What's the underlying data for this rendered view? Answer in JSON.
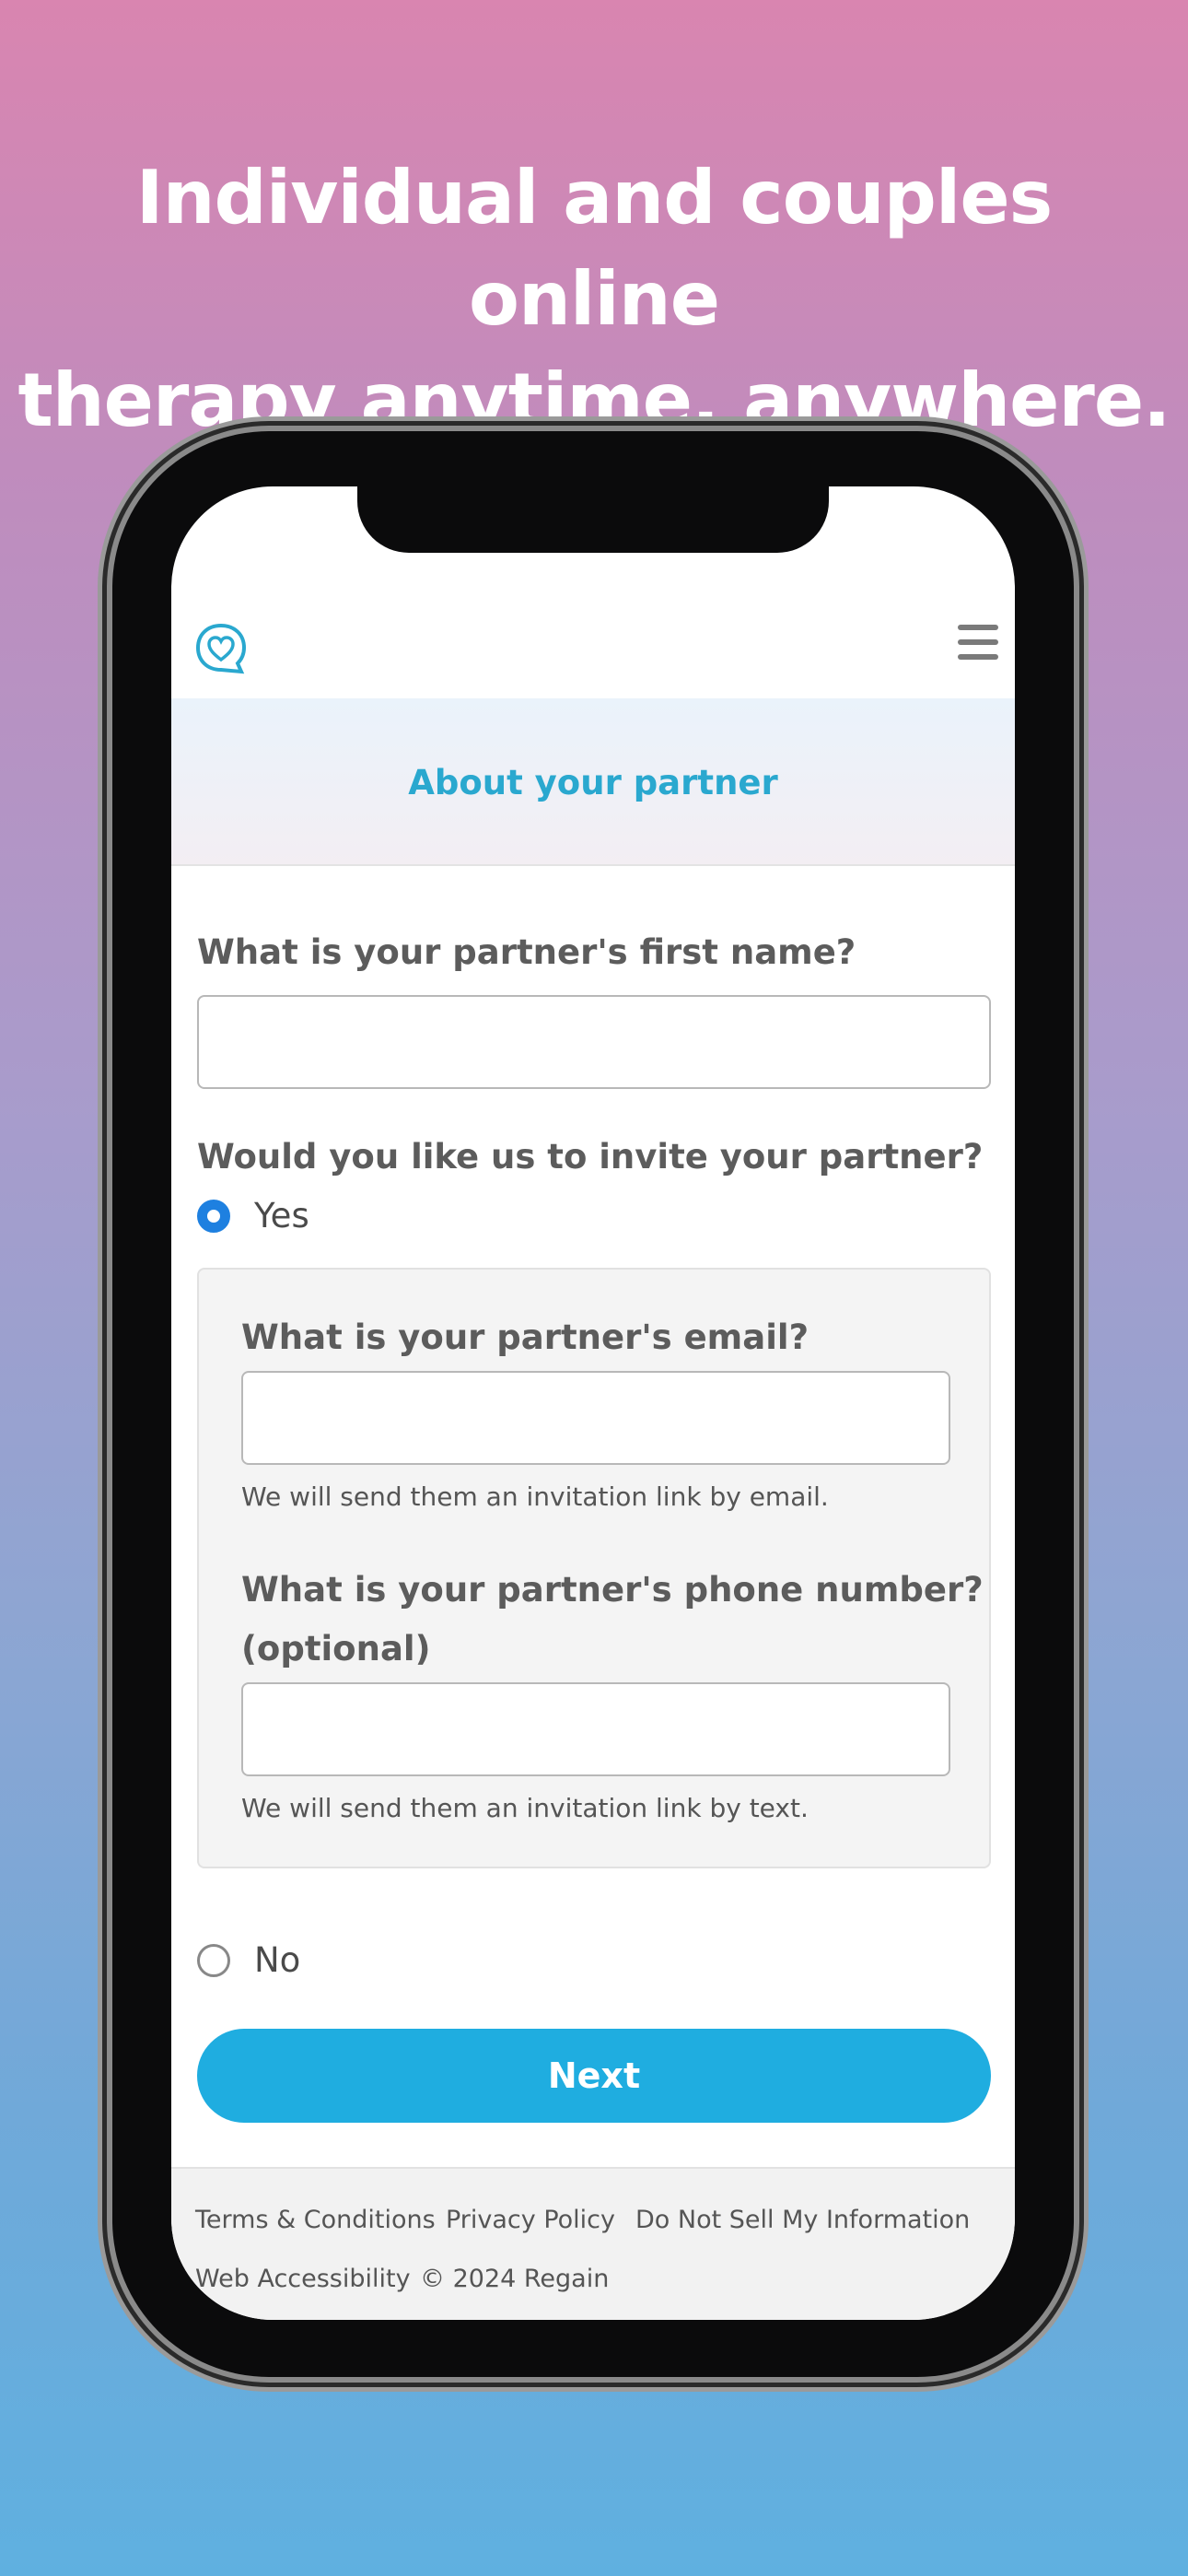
{
  "headline": {
    "line1": "Individual and couples online",
    "line2": "therapy anytime, anywhere."
  },
  "app": {
    "logo_icon": "heart-chat-bubble-icon",
    "menu_icon": "hamburger-menu-icon",
    "brand_color": "#2aa8cf"
  },
  "banner": {
    "title": "About your partner"
  },
  "form": {
    "first_name_label": "What is your partner's first name?",
    "first_name_value": "",
    "invite_label": "Would you like us to invite your partner?",
    "yes_label": "Yes",
    "yes_selected": true,
    "email_label": "What is your partner's email?",
    "email_value": "",
    "email_hint": "We will send them an invitation link by email.",
    "phone_label_line1": "What is your partner's phone number?",
    "phone_label_line2": "(optional)",
    "phone_value": "",
    "phone_hint": "We will send them an invitation link by text.",
    "no_label": "No",
    "no_selected": false,
    "next_label": "Next",
    "next_color": "#1fade0"
  },
  "footer": {
    "terms": "Terms & Conditions",
    "privacy": "Privacy Policy",
    "do_not_sell": "Do Not Sell My Information",
    "accessibility": "Web Accessibility",
    "copyright": "© 2024 Regain"
  }
}
